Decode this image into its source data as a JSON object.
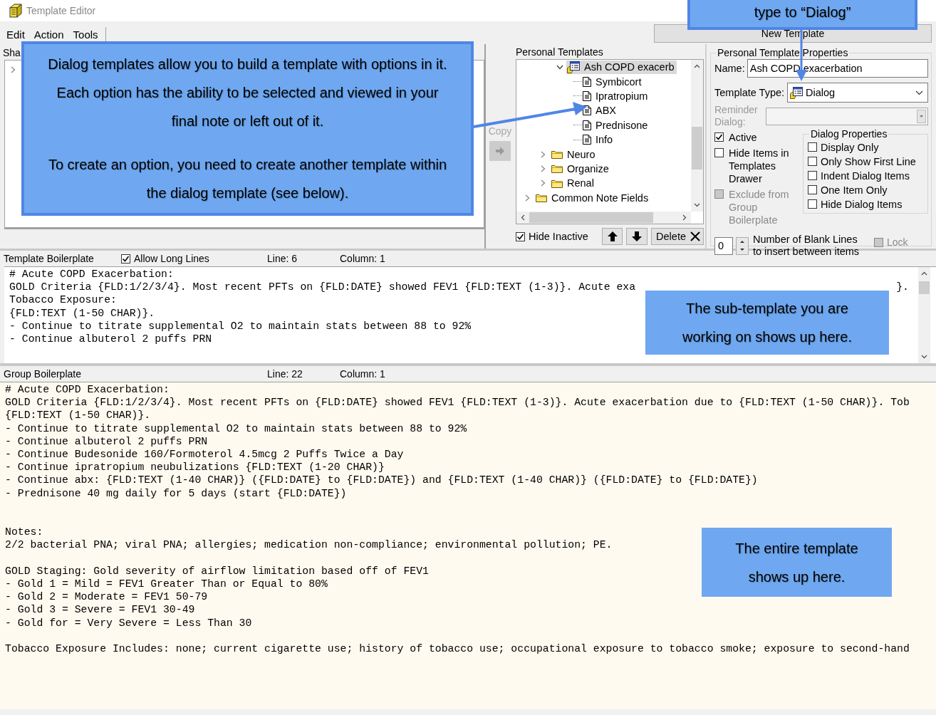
{
  "window": {
    "title": "Template Editor"
  },
  "menu": [
    "Edit",
    "Action",
    "Tools"
  ],
  "new_template_button": "New Template",
  "shared_panel": {
    "tab_label": "Sha"
  },
  "copy": {
    "label": "Copy",
    "disabled": true
  },
  "personal_templates": {
    "label": "Personal Templates",
    "tree": [
      {
        "children": [
          {
            "children": [
              {
                "label": "Ash COPD exacerb",
                "kind": "dialog",
                "expanded": true,
                "selected": true,
                "children": [
                  {
                    "label": "Symbicort",
                    "kind": "document",
                    "selected": false
                  },
                  {
                    "label": "Ipratropium",
                    "kind": "document",
                    "selected": false
                  },
                  {
                    "label": "ABX",
                    "kind": "document",
                    "selected": false
                  },
                  {
                    "label": "Prednisone",
                    "kind": "document",
                    "selected": false
                  },
                  {
                    "label": "Info",
                    "kind": "document",
                    "selected": false
                  }
                ]
              }
            ]
          },
          {
            "label": "Neuro",
            "kind": "folder",
            "expanded": false,
            "selected": false
          },
          {
            "label": "Organize",
            "kind": "folder",
            "expanded": false,
            "selected": false
          },
          {
            "label": "Renal",
            "kind": "folder",
            "expanded": false,
            "selected": false
          }
        ]
      },
      {
        "label": "Common Note Fields",
        "kind": "folder",
        "expanded": false,
        "selected": false
      }
    ],
    "hide_inactive": {
      "label": "Hide Inactive",
      "checked": true
    },
    "delete_button": "Delete"
  },
  "properties": {
    "title": "Personal Template Properties",
    "name_label": "Name:",
    "name_value": "Ash COPD exacerbation",
    "type_label": "Template Type:",
    "type_value": "Dialog",
    "reminder_label": "Reminder Dialog:",
    "checks": [
      {
        "label": "Active",
        "checked": true,
        "disabled": false
      },
      {
        "label": "Hide Items in Templates Drawer",
        "checked": false,
        "disabled": false
      },
      {
        "label": "Exclude from Group Boilerplate",
        "checked": false,
        "disabled": true
      }
    ],
    "dialog_properties": {
      "title": "Dialog Properties",
      "options": [
        {
          "label": "Display Only",
          "checked": false
        },
        {
          "label": "Only Show First Line",
          "checked": false
        },
        {
          "label": "Indent Dialog Items",
          "checked": false
        },
        {
          "label": "One Item Only",
          "checked": false
        },
        {
          "label": "Hide Dialog Items",
          "checked": false
        }
      ]
    },
    "blank_lines": {
      "value": "0",
      "label": "Number of Blank Lines to insert between items"
    },
    "lock": {
      "label": "Lock",
      "checked": false,
      "disabled": true
    }
  },
  "template_boilerplate": {
    "title": "Template Boilerplate",
    "allow_long_lines": {
      "label": "Allow Long Lines",
      "checked": true
    },
    "line": "Line: 6",
    "column": "Column: 1",
    "paragraphs": [
      {
        "kind": "first",
        "lines": [
          {
            "text": "# Acute COPD Exacerbation:"
          },
          {
            "text": "GOLD Criteria {FLD:1/2/3/4}. Most recent PFTs on {FLD:DATE} showed FEV1 {FLD:TEXT (1-3)}. Acute exa",
            "tail": "}."
          },
          {
            "text": "Tobacco Exposure:"
          },
          {
            "text": "{FLD:TEXT (1-50 CHAR)}."
          },
          {
            "text": "- Continue to titrate supplemental O2 to maintain stats between 88 to 92%"
          },
          {
            "text": "- Continue albuterol 2 puffs PRN"
          }
        ]
      }
    ]
  },
  "group_boilerplate": {
    "title": "Group Boilerplate",
    "line": "Line: 22",
    "column": "Column: 1",
    "paragraphs": [
      {
        "kind": "first",
        "lines": [
          {
            "text": "# Acute COPD Exacerbation:"
          },
          {
            "text": "GOLD Criteria {FLD:1/2/3/4}. Most recent PFTs on {FLD:DATE} showed FEV1 {FLD:TEXT (1-3)}. Acute exacerbation due to {FLD:TEXT (1-50 CHAR)}. Tob"
          },
          {
            "text": "{FLD:TEXT (1-50 CHAR)}."
          },
          {
            "text": "- Continue to titrate supplemental O2 to maintain stats between 88 to 92%"
          },
          {
            "text": "- Continue albuterol 2 puffs PRN"
          },
          {
            "text": "- Continue Budesonide 160/Formoterol 4.5mcg 2 Puffs Twice a Day"
          },
          {
            "text": "- Continue ipratropium neubulizations {FLD:TEXT (1-20 CHAR)}"
          },
          {
            "text": "- Continue abx: {FLD:TEXT (1-40 CHAR)} ({FLD:DATE} to {FLD:DATE}) and {FLD:TEXT (1-40 CHAR)} ({FLD:DATE} to {FLD:DATE})"
          },
          {
            "text": "- Prednisone 40 mg daily for 5 days (start {FLD:DATE})"
          }
        ]
      },
      {
        "kind": "double-gap",
        "lines": [
          {
            "text": "Notes:"
          },
          {
            "text": "2/2 bacterial PNA; viral PNA; allergies; medication non-compliance; environmental pollution; PE."
          }
        ]
      },
      {
        "kind": "gap",
        "lines": [
          {
            "text": "GOLD Staging: Gold severity of airflow limitation based off of FEV1"
          },
          {
            "text": "- Gold 1 = Mild = FEV1 Greater Than or Equal to 80%"
          },
          {
            "text": "- Gold 2 = Moderate = FEV1 50-79"
          },
          {
            "text": "- Gold 3 = Severe = FEV1 30-49"
          },
          {
            "text": "- Gold for = Very Severe = Less Than 30"
          }
        ]
      },
      {
        "kind": "gap",
        "lines": [
          {
            "text": "Tobacco Exposure Includes: none; current cigarette use; history of tobacco use; occupational exposure to tobacco smoke; exposure to second-hand"
          }
        ]
      }
    ]
  },
  "callouts": [
    {
      "kind": "bordered",
      "paragraphs": [
        "Dialog templates allow you to build a template with options in it. Each option has the ability to be selected and viewed in your final note or left out of it.",
        "To create an option, you need to create another template within the dialog template (see below)."
      ]
    },
    {
      "kind": "bordered",
      "paragraphs": [
        "type to “Dialog”"
      ]
    },
    {
      "kind": "plain",
      "paragraphs": [
        "The sub-template you are working on shows up here."
      ]
    },
    {
      "kind": "plain",
      "paragraphs": [
        "The entire template shows up here."
      ]
    }
  ]
}
